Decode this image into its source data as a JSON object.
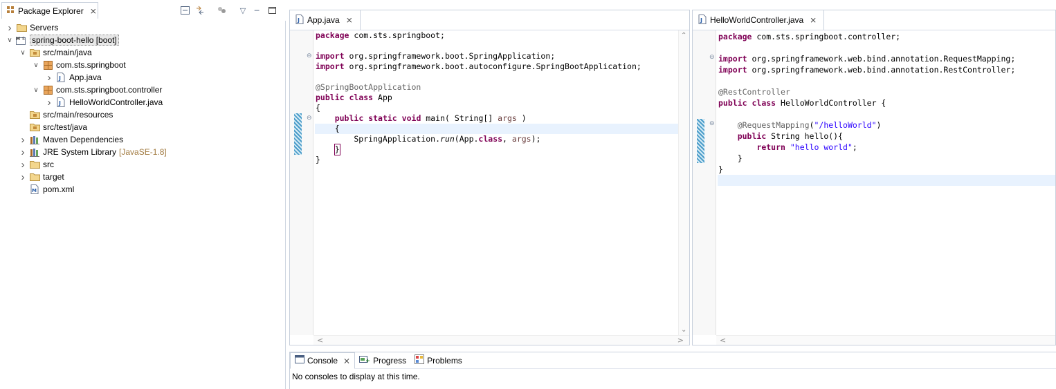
{
  "package_explorer": {
    "title": "Package Explorer",
    "tree": [
      {
        "label": "Servers",
        "icon": "folder-icon",
        "level": 0,
        "expander": "collapsed"
      },
      {
        "label": "spring-boot-hello [boot]",
        "icon": "maven-project-icon",
        "level": 0,
        "expander": "expanded",
        "selected": true
      },
      {
        "label": "src/main/java",
        "icon": "source-folder-icon",
        "level": 1,
        "expander": "expanded"
      },
      {
        "label": "com.sts.springboot",
        "icon": "package-icon",
        "level": 2,
        "expander": "expanded"
      },
      {
        "label": "App.java",
        "icon": "java-file-icon",
        "level": 3,
        "expander": "collapsed"
      },
      {
        "label": "com.sts.springboot.controller",
        "icon": "package-icon",
        "level": 2,
        "expander": "expanded"
      },
      {
        "label": "HelloWorldController.java",
        "icon": "java-file-icon",
        "level": 3,
        "expander": "collapsed"
      },
      {
        "label": "src/main/resources",
        "icon": "source-folder-icon",
        "level": 1,
        "expander": "none"
      },
      {
        "label": "src/test/java",
        "icon": "source-folder-icon",
        "level": 1,
        "expander": "none"
      },
      {
        "label": "Maven Dependencies",
        "icon": "library-icon",
        "level": 1,
        "expander": "collapsed"
      },
      {
        "label": "JRE System Library",
        "suffix": "[JavaSE-1.8]",
        "icon": "library-icon",
        "level": 1,
        "expander": "collapsed"
      },
      {
        "label": "src",
        "icon": "folder-icon",
        "level": 1,
        "expander": "collapsed"
      },
      {
        "label": "target",
        "icon": "folder-icon",
        "level": 1,
        "expander": "collapsed"
      },
      {
        "label": "pom.xml",
        "icon": "maven-pom-icon",
        "level": 1,
        "expander": "none"
      }
    ]
  },
  "editors": [
    {
      "tab": "App.java",
      "lines": [
        "package com.sts.springboot;",
        "",
        "import org.springframework.boot.SpringApplication;",
        "import org.springframework.boot.autoconfigure.SpringBootApplication;",
        "",
        "@SpringBootApplication",
        "public class App",
        "{",
        "    public static void main( String[] args )",
        "    {",
        "        SpringApplication.run(App.class, args);",
        "    }",
        "}"
      ]
    },
    {
      "tab": "HelloWorldController.java",
      "lines": [
        "package com.sts.springboot.controller;",
        "",
        "import org.springframework.web.bind.annotation.RequestMapping;",
        "import org.springframework.web.bind.annotation.RestController;",
        "",
        "@RestController",
        "public class HelloWorldController {",
        "",
        "    @RequestMapping(\"/helloWorld\")",
        "    public String hello(){",
        "        return \"hello world\";",
        "    }",
        "}"
      ]
    }
  ],
  "console": {
    "tabs": [
      {
        "label": "Console",
        "icon": "console-icon",
        "active": true
      },
      {
        "label": "Progress",
        "icon": "progress-icon",
        "active": false
      },
      {
        "label": "Problems",
        "icon": "problems-icon",
        "active": false
      }
    ],
    "message": "No consoles to display at this time."
  }
}
